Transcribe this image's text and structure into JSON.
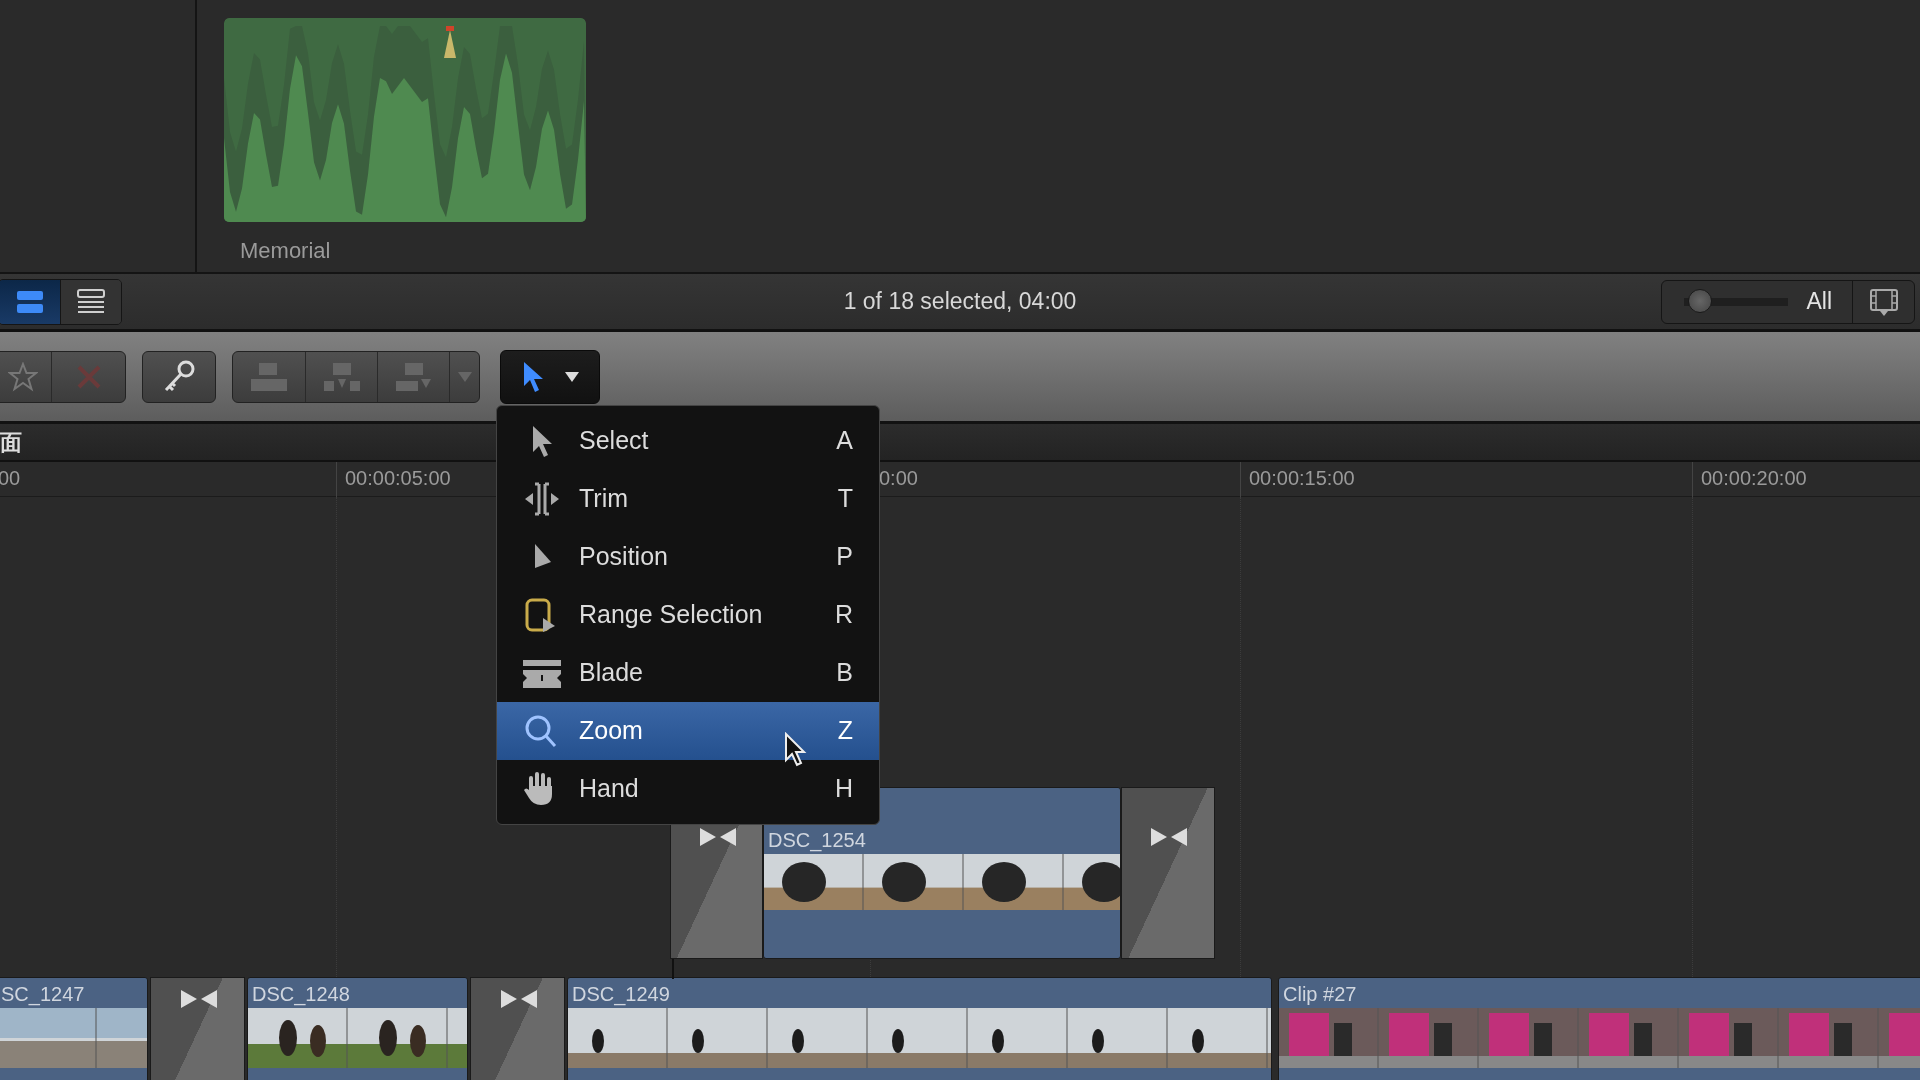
{
  "browser": {
    "clip": {
      "name": "Memorial"
    }
  },
  "status_bar": {
    "view_buttons": [
      {
        "kind": "filmstrip",
        "selected": true
      },
      {
        "kind": "list",
        "selected": false
      }
    ],
    "selection_info": "1 of 18 selected, 04:00",
    "zoom_slider": {
      "level": 0.05
    },
    "duration_label": "All"
  },
  "tool_menu": {
    "items": [
      {
        "kind": "select",
        "label": "Select",
        "shortcut": "A",
        "selected": false
      },
      {
        "kind": "trim",
        "label": "Trim",
        "shortcut": "T",
        "selected": false
      },
      {
        "kind": "position",
        "label": "Position",
        "shortcut": "P",
        "selected": false
      },
      {
        "kind": "range",
        "label": "Range Selection",
        "shortcut": "R",
        "selected": false
      },
      {
        "kind": "blade",
        "label": "Blade",
        "shortcut": "B",
        "selected": false
      },
      {
        "kind": "zoom",
        "label": "Zoom",
        "shortcut": "Z",
        "selected": true
      },
      {
        "kind": "hand",
        "label": "Hand",
        "shortcut": "H",
        "selected": false
      }
    ]
  },
  "timeline": {
    "header": "面",
    "ruler": [
      "00",
      "00:00:05:00",
      "0:00",
      "00:00:15:00",
      "00:00:20:00"
    ],
    "connected": [
      {
        "kind": "transition"
      },
      {
        "kind": "clip",
        "name": "DSC_1254"
      },
      {
        "kind": "transition"
      }
    ],
    "storyline": [
      {
        "kind": "clip",
        "name": "SC_1247"
      },
      {
        "kind": "transition"
      },
      {
        "kind": "clip",
        "name": "DSC_1248"
      },
      {
        "kind": "transition"
      },
      {
        "kind": "clip",
        "name": "DSC_1249"
      },
      {
        "kind": "clip",
        "name": "Clip #27"
      }
    ]
  }
}
